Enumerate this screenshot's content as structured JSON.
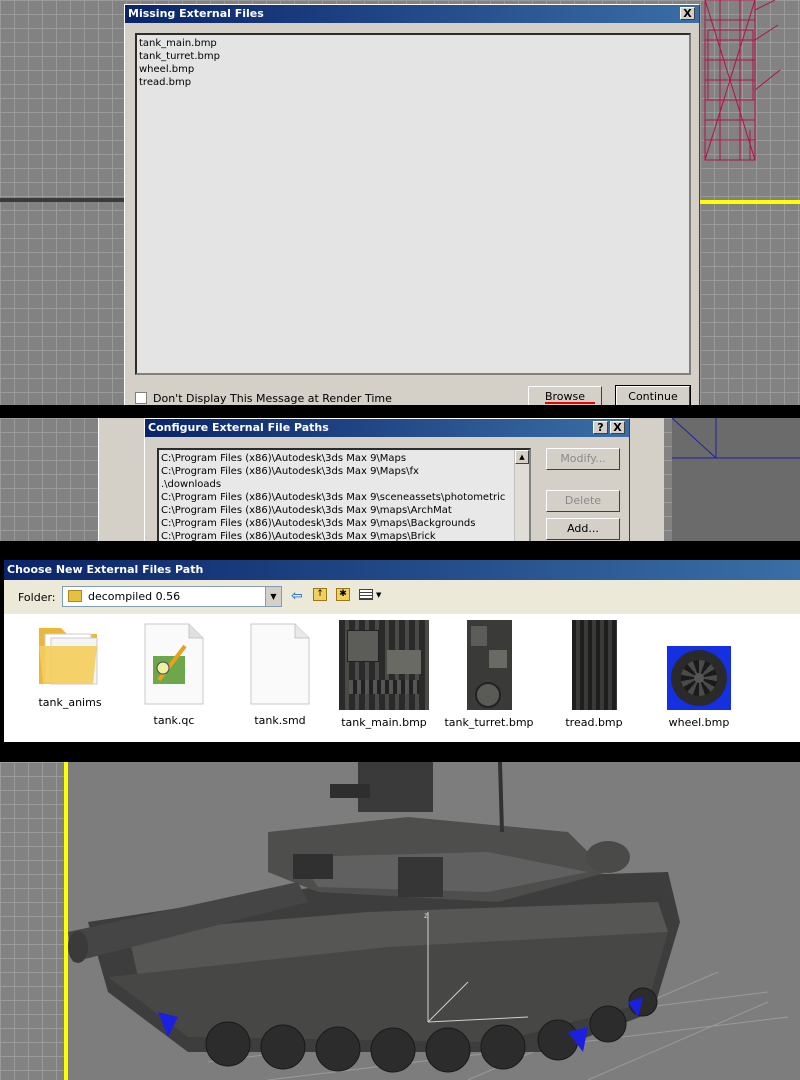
{
  "missing_dialog": {
    "title": "Missing External Files",
    "close_glyph": "X",
    "files": [
      "tank_main.bmp",
      "tank_turret.bmp",
      "wheel.bmp",
      "tread.bmp"
    ],
    "checkbox_label": "Don't Display This Message at Render Time",
    "browse_label": "Browse",
    "continue_label": "Continue"
  },
  "paths_dialog": {
    "title": "Configure External File Paths",
    "help_glyph": "?",
    "close_glyph": "X",
    "paths": [
      "C:\\Program Files (x86)\\Autodesk\\3ds Max 9\\Maps",
      "C:\\Program Files (x86)\\Autodesk\\3ds Max 9\\Maps\\fx",
      ".\\downloads",
      "C:\\Program Files (x86)\\Autodesk\\3ds Max 9\\sceneassets\\photometric",
      "C:\\Program Files (x86)\\Autodesk\\3ds Max 9\\maps\\ArchMat",
      "C:\\Program Files (x86)\\Autodesk\\3ds Max 9\\maps\\Backgrounds",
      "C:\\Program Files (x86)\\Autodesk\\3ds Max 9\\maps\\Brick"
    ],
    "modify_label": "Modify...",
    "delete_label": "Delete",
    "add_label": "Add..."
  },
  "choose_dialog": {
    "title": "Choose New External Files Path",
    "folder_label": "Folder:",
    "folder_value": "decompiled 0.56",
    "files": [
      {
        "name": "tank_anims",
        "icon": "folder-icon"
      },
      {
        "name": "tank.qc",
        "icon": "qc-file-icon"
      },
      {
        "name": "tank.smd",
        "icon": "blank-file-icon"
      },
      {
        "name": "tank_main.bmp",
        "icon": "texture-thumbnail"
      },
      {
        "name": "tank_turret.bmp",
        "icon": "texture-thumbnail"
      },
      {
        "name": "tread.bmp",
        "icon": "texture-thumbnail"
      },
      {
        "name": "wheel.bmp",
        "icon": "texture-thumbnail"
      }
    ]
  },
  "colors": {
    "title_bar": "#0a246a",
    "dialog_bg": "#d4d0c8",
    "wireframe": "#b0124a",
    "viewport_bg": "#828282",
    "viewport_border": "#ffff00"
  }
}
